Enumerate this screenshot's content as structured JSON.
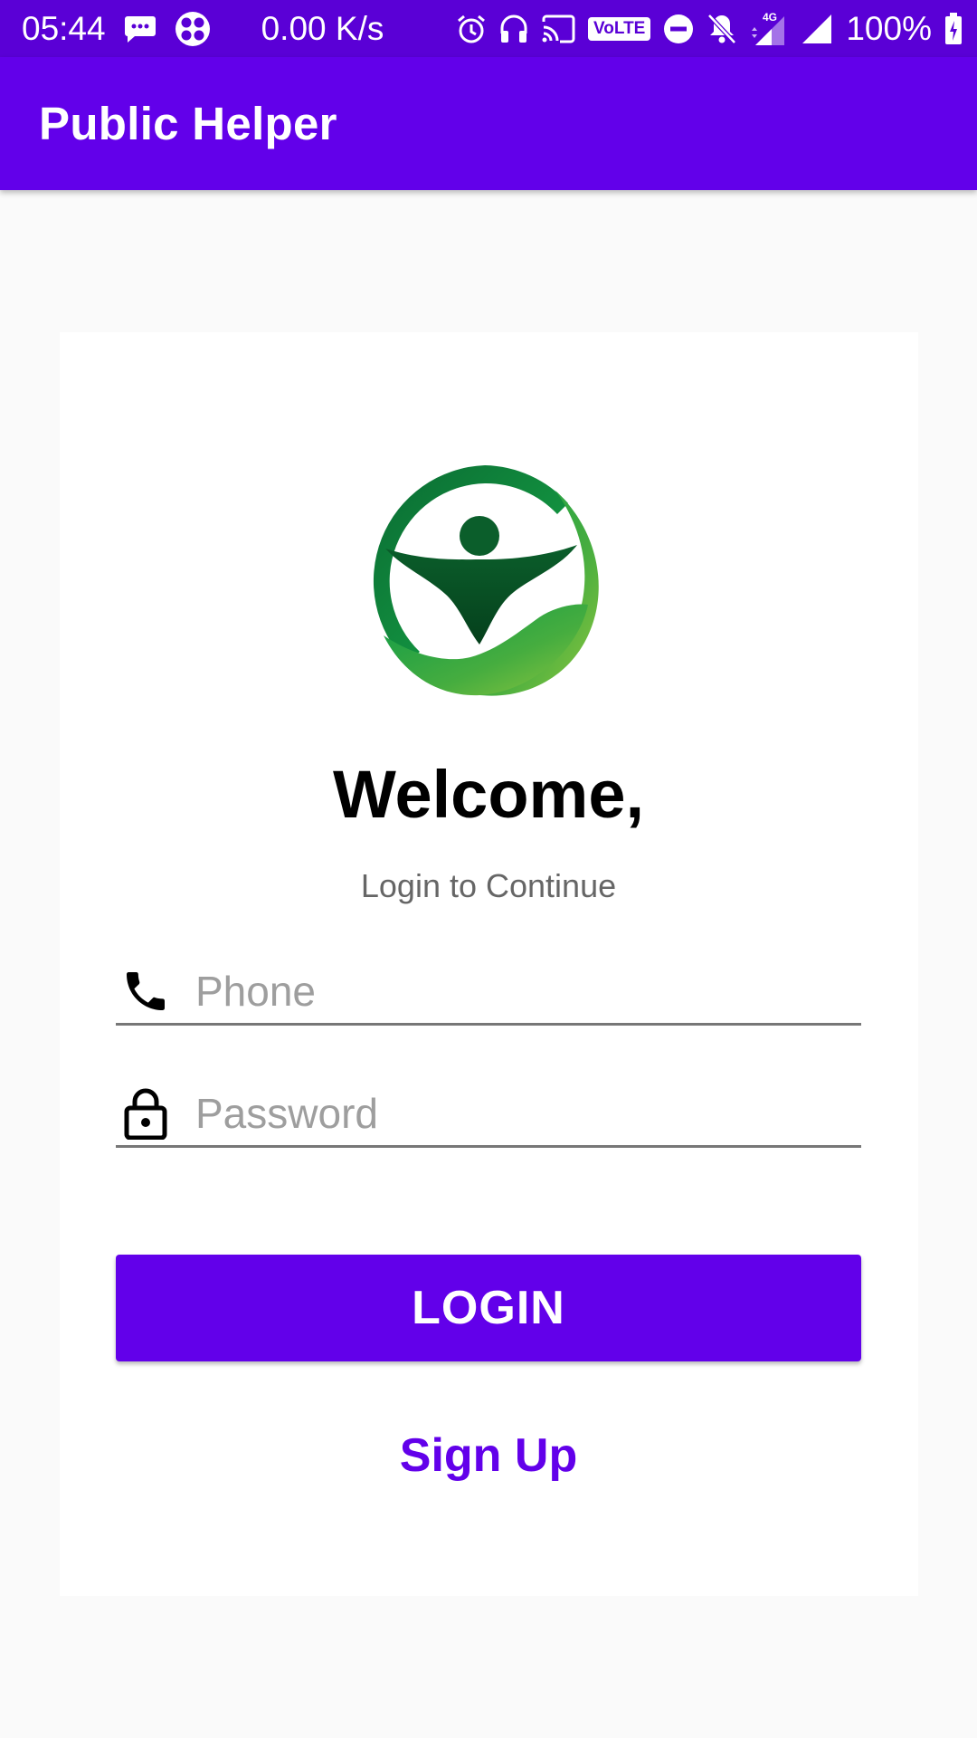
{
  "status_bar": {
    "time": "05:44",
    "network_speed": "0.00 K/s",
    "volte_label": "VoLTE",
    "network_type": "4G",
    "battery": "100%",
    "icons": [
      "message-icon",
      "app-notification-icon",
      "alarm-icon",
      "headphones-icon",
      "cast-icon",
      "volte-icon",
      "do-not-disturb-icon",
      "notifications-off-icon",
      "signal-4g-icon",
      "signal-icon",
      "battery-icon"
    ]
  },
  "app_bar": {
    "title": "Public Helper"
  },
  "login": {
    "welcome": "Welcome,",
    "subtitle": "Login to Continue",
    "phone_placeholder": "Phone",
    "password_placeholder": "Password",
    "login_button": "LOGIN",
    "signup_link": "Sign Up"
  },
  "colors": {
    "primary": "#6200ea",
    "status_bar": "#5a00d6",
    "background": "#fafafa",
    "logo_dark_green": "#0a5a2a",
    "logo_light_green": "#7cc242"
  }
}
